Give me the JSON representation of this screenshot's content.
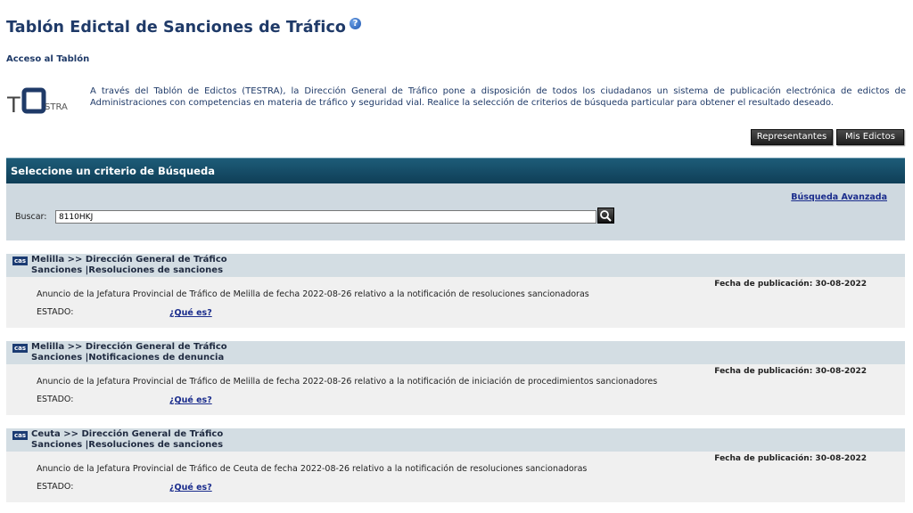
{
  "header": {
    "title": "Tablón Edictal de Sanciones de Tráfico",
    "help_symbol": "?",
    "access_link": "Acceso al Tablón"
  },
  "logo": {
    "text_t": "T",
    "text_stra": "STRA"
  },
  "intro_text": "A través del Tablón de Edictos (TESTRA), la Dirección General de Tráfico pone a disposición de todos los ciudadanos un sistema de publicación electrónica de edictos de Administraciones con competencias en materia de tráfico y seguridad vial. Realice la selección de criterios de búsqueda particular para obtener el resultado deseado.",
  "buttons": {
    "representantes": "Representantes",
    "mis_edictos": "Mis Edictos"
  },
  "search": {
    "panel_title": "Seleccione un criterio de Búsqueda",
    "advanced_link": "Búsqueda Avanzada",
    "label": "Buscar:",
    "value": "8110HKJ"
  },
  "results": [
    {
      "badge": "cas",
      "line1": "Melilla >> Dirección General de Tráfico",
      "line2": "Sanciones |Resoluciones de sanciones",
      "date": "Fecha de publicación: 30-08-2022",
      "description": "Anuncio de la Jefatura Provincial de Tráfico de Melilla de fecha 2022-08-26 relativo a la notificación de resoluciones sancionadoras",
      "estado_label": "ESTADO:",
      "que_es": "¿Qué es?"
    },
    {
      "badge": "cas",
      "line1": "Melilla >> Dirección General de Tráfico",
      "line2": "Sanciones |Notificaciones de denuncia",
      "date": "Fecha de publicación: 30-08-2022",
      "description": "Anuncio de la Jefatura Provincial de Tráfico de Melilla de fecha 2022-08-26 relativo a la notificación de iniciación de procedimientos sancionadores",
      "estado_label": "ESTADO:",
      "que_es": "¿Qué es?"
    },
    {
      "badge": "cas",
      "line1": "Ceuta >> Dirección General de Tráfico",
      "line2": "Sanciones |Resoluciones de sanciones",
      "date": "Fecha de publicación: 30-08-2022",
      "description": "Anuncio de la Jefatura Provincial de Tráfico de Ceuta de fecha 2022-08-26 relativo a la notificación de resoluciones sancionadoras",
      "estado_label": "ESTADO:",
      "que_es": "¿Qué es?"
    }
  ]
}
